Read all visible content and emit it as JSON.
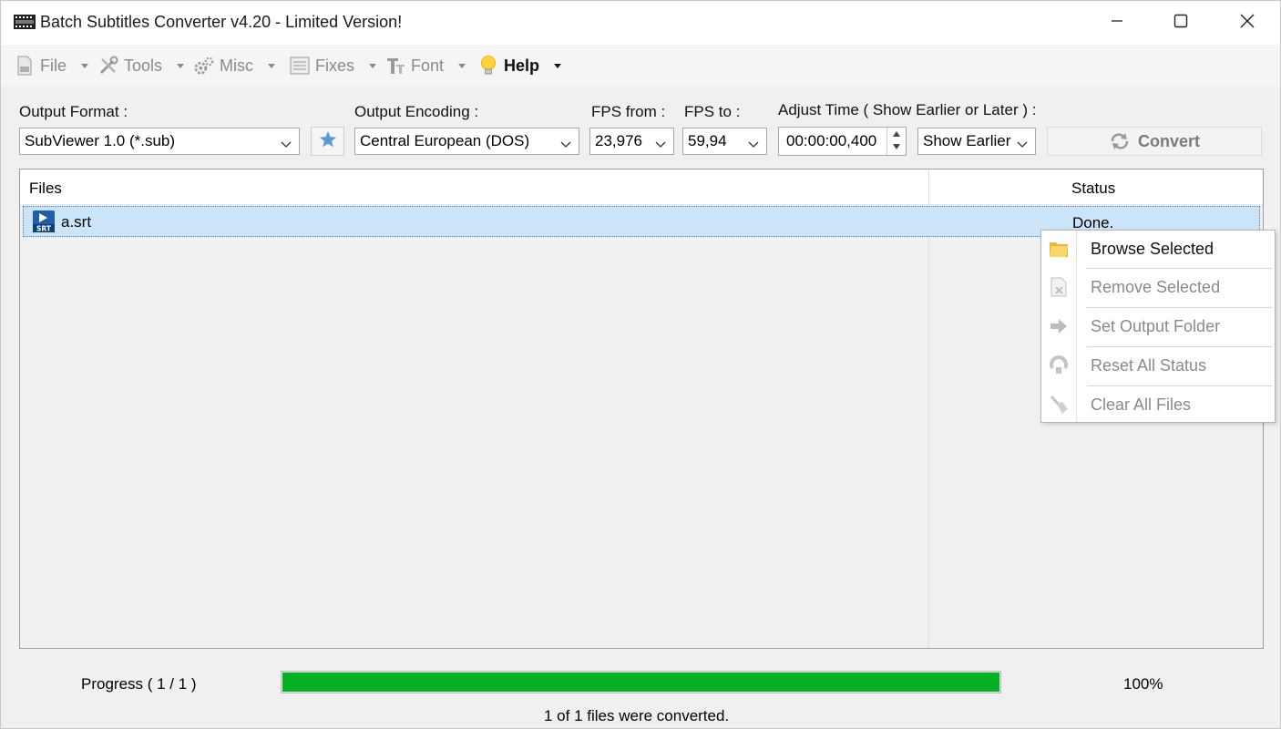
{
  "window": {
    "title": "Batch Subtitles Converter v4.20 - Limited Version!",
    "icons": {
      "app": "film-strip-icon",
      "minimize": "minimize-icon",
      "maximize": "maximize-icon",
      "close": "close-icon"
    }
  },
  "menu": {
    "items": [
      {
        "label": "File",
        "icon": "file-icon"
      },
      {
        "label": "Tools",
        "icon": "tools-icon"
      },
      {
        "label": "Misc",
        "icon": "gears-icon"
      },
      {
        "label": "Fixes",
        "icon": "list-icon"
      },
      {
        "label": "Font",
        "icon": "font-icon"
      },
      {
        "label": "Help",
        "icon": "lightbulb-icon"
      }
    ]
  },
  "toolbar": {
    "output_format_label": "Output Format :",
    "output_format_value": "SubViewer 1.0 (*.sub)",
    "output_encoding_label": "Output Encoding :",
    "output_encoding_value": "Central European (DOS)",
    "fps_from_label": "FPS from :",
    "fps_from_value": "23,976",
    "fps_to_label": "FPS to :",
    "fps_to_value": "59,94",
    "adjust_time_label": "Adjust Time ( Show Earlier or Later ) :",
    "adjust_time_value": "00:00:00,400",
    "direction_value": "Show Earlier",
    "convert_label": "Convert",
    "favorite_icon": "star-icon"
  },
  "file_list": {
    "columns": [
      "Files",
      "Status"
    ],
    "rows": [
      {
        "name": "a.srt",
        "status": "Done.",
        "icon": "srt-file-icon",
        "selected": true
      }
    ]
  },
  "context_menu": {
    "items": [
      {
        "label": "Browse Selected",
        "icon": "folder-icon",
        "enabled": true
      },
      {
        "label": "Remove Selected",
        "icon": "remove-file-icon",
        "enabled": false
      },
      {
        "label": "Set Output Folder",
        "icon": "arrow-right-icon",
        "enabled": false
      },
      {
        "label": "Reset All Status",
        "icon": "reset-icon",
        "enabled": false
      },
      {
        "label": "Clear All Files",
        "icon": "broom-icon",
        "enabled": false
      }
    ]
  },
  "progress": {
    "label": "Progress ( 1 / 1 )",
    "percent_text": "100%",
    "fraction": 1.0,
    "bar_color": "#06b025",
    "status": "1 of 1 files were converted."
  }
}
